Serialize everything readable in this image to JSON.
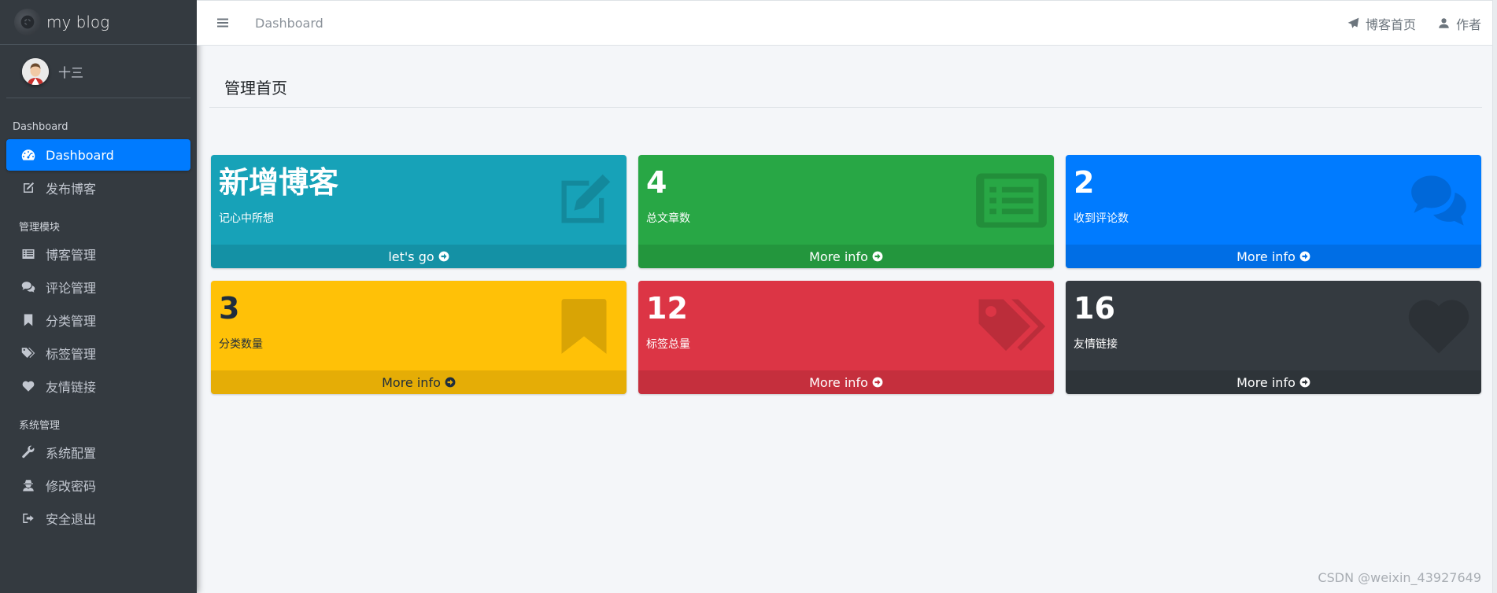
{
  "sidebar": {
    "brand": "my blog",
    "user": "十三",
    "sections": [
      {
        "header": "Dashboard",
        "items": [
          {
            "label": "Dashboard",
            "icon": "dashboard-icon"
          },
          {
            "label": "发布博客",
            "icon": "edit-icon"
          }
        ]
      },
      {
        "header": "管理模块",
        "items": [
          {
            "label": "博客管理",
            "icon": "list-icon"
          },
          {
            "label": "评论管理",
            "icon": "comments-icon"
          },
          {
            "label": "分类管理",
            "icon": "bookmark-icon"
          },
          {
            "label": "标签管理",
            "icon": "tags-icon"
          },
          {
            "label": "友情链接",
            "icon": "heart-icon"
          }
        ]
      },
      {
        "header": "系统管理",
        "items": [
          {
            "label": "系统配置",
            "icon": "wrench-icon"
          },
          {
            "label": "修改密码",
            "icon": "user-secret-icon"
          },
          {
            "label": "安全退出",
            "icon": "sign-out-icon"
          }
        ]
      }
    ]
  },
  "topbar": {
    "breadcrumb": "Dashboard",
    "blog_home": "博客首页",
    "author": "作者"
  },
  "page": {
    "title": "管理首页"
  },
  "cards": [
    {
      "value": "新增博客",
      "label": "记心中所想",
      "footer": "let's go",
      "icon": "edit-icon",
      "color": "#17a2b8"
    },
    {
      "value": "4",
      "label": "总文章数",
      "footer": "More info",
      "icon": "list-alt-icon",
      "color": "#28a745"
    },
    {
      "value": "2",
      "label": "收到评论数",
      "footer": "More info",
      "icon": "comments-icon",
      "color": "#007bff"
    },
    {
      "value": "3",
      "label": "分类数量",
      "footer": "More info",
      "icon": "bookmark-icon",
      "color": "#ffc107"
    },
    {
      "value": "12",
      "label": "标签总量",
      "footer": "More info",
      "icon": "tags-icon",
      "color": "#dc3545"
    },
    {
      "value": "16",
      "label": "友情链接",
      "footer": "More info",
      "icon": "heart-icon",
      "color": "#343a40"
    }
  ],
  "watermark": "CSDN @weixin_43927649"
}
